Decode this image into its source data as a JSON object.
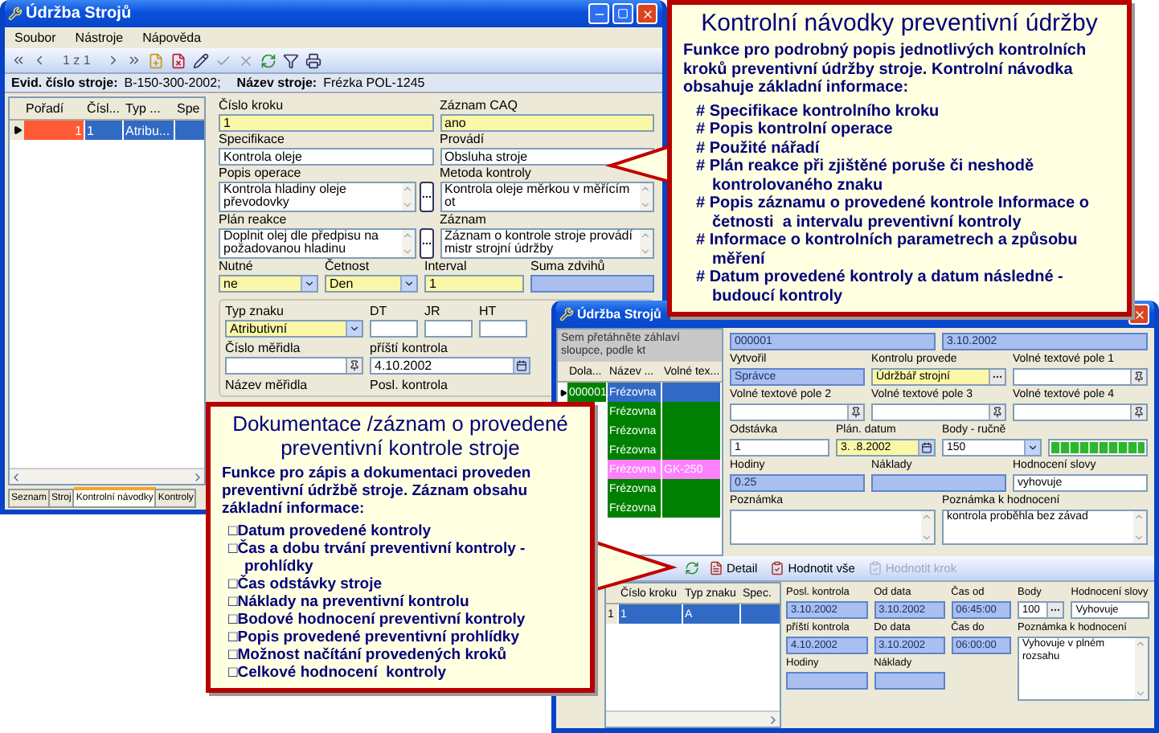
{
  "main_window": {
    "title": "Údržba Strojů",
    "menu": [
      "Soubor",
      "Nástroje",
      "Nápověda"
    ],
    "record_counter": "1 z 1",
    "machine_info": [
      {
        "label": "Evid. číslo stroje:",
        "value": "B-150-300-2002;"
      },
      {
        "label": "Název stroje:",
        "value": "Frézka POL-1245"
      }
    ],
    "step_list": {
      "columns": [
        "Pořadí",
        "Čísl...",
        "Typ ...",
        "Spe"
      ],
      "rows": [
        {
          "cells": [
            "1",
            "1",
            "Atribu..."
          ],
          "selected": true
        }
      ]
    },
    "form_rows": [
      [
        {
          "label": "Číslo kroku",
          "value": "1",
          "kind": "text",
          "required": true,
          "readonly": false
        },
        {
          "label": "Záznam CAQ",
          "value": "ano",
          "kind": "text",
          "required": true,
          "readonly": false
        }
      ],
      [
        {
          "label": "Specifikace",
          "value": "Kontrola oleje",
          "kind": "text",
          "required": false,
          "readonly": false
        },
        {
          "label": "Provádí",
          "value": "Obsluha stroje",
          "kind": "text",
          "required": false,
          "readonly": false
        }
      ],
      [
        {
          "label": "Popis operace",
          "value": "Kontrola hladiny oleje převodovky",
          "kind": "memo_picker",
          "required": false,
          "readonly": false
        },
        {
          "label": "Metoda kontroly",
          "value": "Kontrola oleje měrkou v měřícím ot",
          "kind": "memo",
          "required": false,
          "readonly": false
        }
      ],
      [
        {
          "label": "Plán reakce",
          "value": "Doplnit olej dle předpisu na požadovanou hladinu",
          "kind": "memo_picker",
          "required": false,
          "readonly": false
        },
        {
          "label": "Záznam",
          "value": "Záznam o kontrole stroje provádí mistr strojní údržby",
          "kind": "memo",
          "required": false,
          "readonly": false
        }
      ],
      [
        {
          "label": "Nutné",
          "value": "ne",
          "kind": "combo",
          "required": true,
          "readonly": false
        },
        {
          "label": "Četnost",
          "value": "Den",
          "kind": "combo",
          "required": true,
          "readonly": false
        },
        {
          "label": "Interval",
          "value": "1",
          "kind": "text",
          "required": true,
          "readonly": false
        },
        {
          "label": "Suma zdvihů",
          "kind": "text",
          "required": false,
          "readonly": true
        }
      ]
    ],
    "gauge_rows": [
      [
        {
          "label": "Typ znaku",
          "value": "Atributivní",
          "kind": "combo",
          "required": true,
          "readonly": false
        },
        {
          "label": "DT",
          "kind": "text",
          "required": false,
          "readonly": false
        },
        {
          "label": "JR",
          "kind": "text",
          "required": false,
          "readonly": false
        },
        {
          "label": "HT",
          "kind": "text",
          "required": false,
          "readonly": false
        }
      ],
      [
        {
          "label": "Číslo měřidla",
          "kind": "lookup",
          "required": false,
          "readonly": false
        },
        {
          "label": "příští kontrola",
          "value": "4.10.2002",
          "kind": "date",
          "required": false,
          "readonly": false
        }
      ],
      [
        {
          "label": "Název měřidla",
          "kind": "caption"
        },
        {
          "label": "Posl. kontrola",
          "kind": "caption"
        }
      ]
    ],
    "tabs": [
      {
        "label": "Seznam",
        "selected": false
      },
      {
        "label": "Stroj",
        "selected": false
      },
      {
        "label": "Kontrolní návodky",
        "selected": true
      },
      {
        "label": "Kontroly",
        "selected": false
      }
    ]
  },
  "record_window": {
    "title": "Údržba Strojů",
    "group_hint": "Sem přetáhněte záhlaví sloupce, podle kt",
    "machine_list": {
      "columns": [
        "Dola...",
        "Název ...",
        "Volné tex..."
      ],
      "rows": [
        {
          "code": "000001",
          "name": "Frézovna",
          "selected": true,
          "color": "#008000"
        },
        {
          "name": "Frézovna",
          "selected": false,
          "color": "#008000"
        },
        {
          "name": "Frézovna",
          "selected": false,
          "color": "#008000"
        },
        {
          "name": "Frézovna",
          "selected": false,
          "color": "#008000"
        },
        {
          "name": "Frézovna",
          "note": "GK-250",
          "selected": false,
          "color": "#ff80ff"
        },
        {
          "name": "Frézovna",
          "selected": false,
          "color": "#008000"
        },
        {
          "name": "Frézovna",
          "selected": false,
          "color": "#008000"
        }
      ]
    },
    "record_rows": [
      [
        {
          "value": "000001",
          "kind": "text",
          "required": false,
          "readonly": true
        },
        {
          "value": "3.10.2002",
          "kind": "text",
          "required": false,
          "readonly": true
        }
      ],
      [
        {
          "label": "Vytvořil",
          "value": "Správce",
          "kind": "text",
          "required": false,
          "readonly": true
        },
        {
          "label": "Kontrolu provede",
          "value": "Údržbář strojní",
          "kind": "picker",
          "required": true,
          "readonly": false
        },
        {
          "label": "Volné textové pole 1",
          "kind": "lookup",
          "required": false,
          "readonly": false
        }
      ],
      [
        {
          "label": "Volné textové pole 2",
          "kind": "lookup",
          "required": false,
          "readonly": false
        },
        {
          "label": "Volné textové pole 3",
          "kind": "lookup",
          "required": false,
          "readonly": false
        },
        {
          "label": "Volné textové pole 4",
          "kind": "lookup",
          "required": false,
          "readonly": false
        }
      ],
      [
        {
          "label": "Odstávka",
          "value": "1",
          "kind": "text",
          "required": false,
          "readonly": false
        },
        {
          "label": "Plán. datum",
          "value": "3. .8.2002",
          "kind": "date",
          "required": true,
          "readonly": false
        },
        {
          "label": "Body - ručně",
          "value": "150",
          "kind": "combo",
          "required": false,
          "readonly": false
        },
        {
          "kind": "meter",
          "level": 1
        }
      ],
      [
        {
          "label": "Hodiny",
          "value": "0.25",
          "kind": "text",
          "required": false,
          "readonly": true
        },
        {
          "label": "Náklady",
          "kind": "text",
          "required": false,
          "readonly": true
        },
        {
          "label": "Hodnocení slovy",
          "value": "vyhovuje",
          "kind": "text",
          "required": false,
          "readonly": false
        }
      ],
      [
        {
          "label": "Poznámka",
          "kind": "memo",
          "required": false,
          "readonly": false
        },
        {
          "label": "Poznámka k hodnocení",
          "value": "kontrola proběhla bez závad",
          "kind": "memo",
          "required": false,
          "readonly": false
        }
      ]
    ],
    "actions": [
      {
        "label": "Detail",
        "disabled": false
      },
      {
        "label": "Hodnotit vše",
        "disabled": false
      },
      {
        "label": "Hodnotit krok",
        "disabled": true
      }
    ],
    "step_list": {
      "columns": [
        "Číslo kroku",
        "Typ znaku",
        "Spec."
      ],
      "rows": [
        {
          "number": "1",
          "cells": [
            "1",
            "A"
          ],
          "selected": true
        }
      ]
    },
    "check_rows": [
      [
        {
          "label": "Posl. kontrola",
          "value": "3.10.2002",
          "kind": "text",
          "required": false,
          "readonly": true
        },
        {
          "label": "Od data",
          "value": "3.10.2002",
          "kind": "text",
          "required": false,
          "readonly": true
        },
        {
          "label": "Čas od",
          "value": "06:45:00",
          "kind": "text",
          "required": false,
          "readonly": true
        }
      ],
      [
        {
          "label": "příští kontrola",
          "value": "4.10.2002",
          "kind": "text",
          "required": false,
          "readonly": true
        },
        {
          "label": "Do data",
          "value": "3.10.2002",
          "kind": "text",
          "required": false,
          "readonly": true
        },
        {
          "label": "Čas do",
          "value": "06:00:00",
          "kind": "text",
          "required": false,
          "readonly": true
        }
      ],
      [
        {
          "label": "Hodiny",
          "kind": "text",
          "required": false,
          "readonly": true
        },
        {
          "label": "Náklady",
          "kind": "text",
          "required": false,
          "readonly": true
        }
      ]
    ],
    "rating_rows": [
      [
        {
          "label": "Body",
          "value": "100",
          "kind": "picker",
          "required": false,
          "readonly": false
        },
        {
          "label": "Hodnocení slovy",
          "value": "Vyhovuje",
          "kind": "text",
          "required": false,
          "readonly": false
        }
      ],
      [
        {
          "label": "Poznámka k hodnocení",
          "value": "Vyhovuje v plném rozsahu",
          "kind": "memo",
          "required": false,
          "readonly": false
        }
      ]
    ]
  },
  "callouts": [
    {
      "title": "Kontrolní návodky preventivní údržby",
      "intro": "Funkce pro podrobný popis jednotlivých kontrolních kroků preventivní údržby stroje. Kontrolní návodka obsahuje základní informace:",
      "items": [
        "# Specifikace kontrolního kroku",
        "# Popis kontrolní operace",
        "# Použité nářadí",
        "# Plán reakce při zjištěné poruše či neshodě kontrolovaného znaku",
        "# Popis záznamu o provedené kontrole Informace o četnosti  a intervalu preventivní kontroly",
        "# Informace o kontrolních parametrech a způsobu měření",
        "# Datum provedené kontroly a datum následné - budoucí kontroly"
      ]
    },
    {
      "title": "Dokumentace /záznam o provedené preventivní kontrole stroje",
      "intro": "Funkce pro zápis a dokumentaci proveden preventivní údržbě stroje. Záznam obsahu základní informace:",
      "items": [
        "□Datum provedené kontroly",
        "□Čas a dobu trvání preventivní kontroly - prohlídky",
        "□Čas odstávky stroje",
        "□Náklady na preventivní kontrolu",
        "□Bodové hodnocení preventivní kontroly",
        "□Popis provedené preventivní prohlídky",
        "□Možnost načítání provedených kroků",
        "□Celkové hodnocení  kontroly"
      ]
    }
  ]
}
